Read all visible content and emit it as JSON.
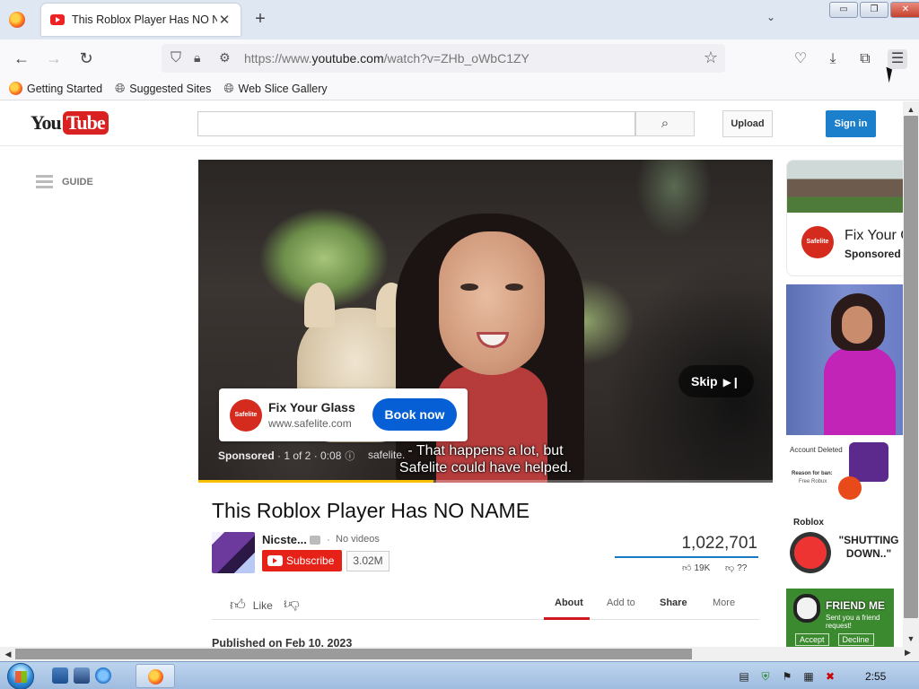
{
  "browser": {
    "tab_title": "This Roblox Player Has NO NAME",
    "tab_close": "✕",
    "new_tab": "+",
    "tab_list": "⌄",
    "url_prefix": "https://www.",
    "url_domain": "youtube.com",
    "url_path": "/watch?v=ZHb_oWbC1ZY",
    "window_buttons": {
      "minimize": "▭",
      "restore": "❐",
      "close": "✕"
    },
    "nav": {
      "back": "←",
      "forward": "→",
      "reload": "↻"
    },
    "icons": {
      "shield": "shield-icon",
      "lock": "lock-icon",
      "star": "star-icon",
      "pocket": "pocket-icon",
      "download": "download-icon",
      "extensions": "extensions-icon",
      "menu": "menu-icon"
    },
    "bookmarks": [
      {
        "label": "Getting Started",
        "icon": "firefox-icon"
      },
      {
        "label": "Suggested Sites",
        "icon": "globe-icon"
      },
      {
        "label": "Web Slice Gallery",
        "icon": "globe-icon"
      }
    ]
  },
  "youtube": {
    "logo_you": "You",
    "logo_tube": "Tube",
    "search_placeholder": "",
    "upload_label": "Upload",
    "signin_label": "Sign in",
    "guide_label": "GUIDE"
  },
  "ad": {
    "title": "Fix Your Glass",
    "url": "www.safelite.com",
    "logo_text": "Safelite",
    "cta": "Book now",
    "skip_label": "Skip",
    "sponsored": "Sponsored",
    "info": " · 1 of 2 · 0:08",
    "domain": "safelite.",
    "caption_line1": "- That happens a lot, but",
    "caption_line2": "Safelite could have helped.",
    "progress": 0.41
  },
  "video": {
    "title": "This Roblox Player Has NO NAME",
    "channel_name": "Nicste...",
    "channel_videos": "No videos",
    "channel_dot": "·",
    "subscribe_label": "Subscribe",
    "subscriber_count": "3.02M",
    "view_count": "1,022,701",
    "likes": "19K",
    "dislikes": "??",
    "like_ratio": 1.0,
    "like_label": "Like",
    "tabs": [
      "About",
      "Add to",
      "Share",
      "More"
    ],
    "published": "Published on Feb 10, 2023"
  },
  "sidebar": {
    "ad_title": "Fix Your G",
    "ad_sponsored": "Sponsored",
    "ad_logo_text": "Safelite",
    "rec1_line1": "Account Deleted",
    "rec1_line2": "Reason for ban:",
    "rec1_line3": "Free Robux",
    "rec2_byline": "Roblox",
    "rec2_text": "\"SHUTTING DOWN..\"",
    "rec3_title": "FRIEND ME",
    "rec3_sub": "Sent you a friend request!",
    "rec3_accept": "Accept",
    "rec3_decline": "Decline"
  },
  "taskbar": {
    "clock": "2:55"
  }
}
